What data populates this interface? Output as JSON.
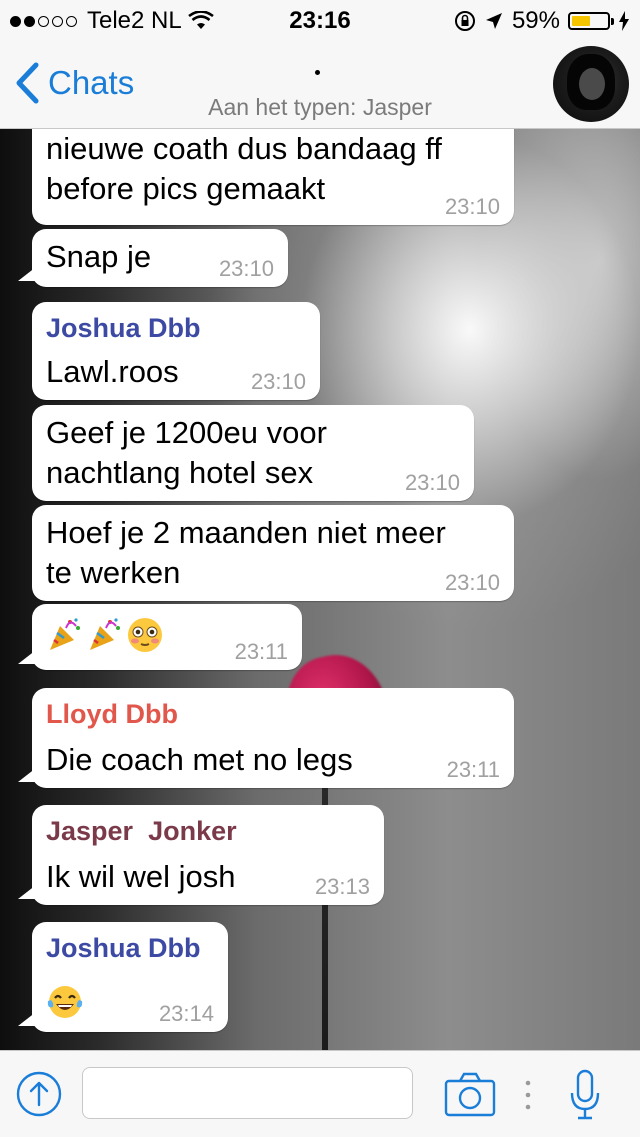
{
  "status_bar": {
    "carrier": "Tele2 NL",
    "time": "23:16",
    "battery_percent": "59%",
    "battery_level": 0.59
  },
  "nav": {
    "back_label": "Chats",
    "subtitle": "Aan het typen: Jasper"
  },
  "messages": [
    {
      "sender": "",
      "text": "nieuwe coath dus bandaag ff\nbefore pics gemaakt",
      "time": "23:10"
    },
    {
      "sender": "",
      "text": "Snap je",
      "time": "23:10"
    },
    {
      "sender": "Joshua Dbb",
      "text": "Lawl.roos",
      "time": "23:10",
      "sender_color": "#3d4aa3"
    },
    {
      "sender": "",
      "text": "Geef je 1200eu voor\nnachtlang hotel sex",
      "time": "23:10"
    },
    {
      "sender": "",
      "text": "Hoef je 2 maanden niet meer\nte werken",
      "time": "23:10"
    },
    {
      "sender": "",
      "text": "party-popper party-popper flushed-face",
      "time": "23:11"
    },
    {
      "sender": "Lloyd Dbb",
      "text": "Die coach met no legs",
      "time": "23:11",
      "sender_color": "#e2574c"
    },
    {
      "sender": "Jasper  Jonker",
      "text": "Ik wil wel josh",
      "time": "23:13",
      "sender_color": "#7b3a4a"
    },
    {
      "sender": "Joshua Dbb",
      "text": "tears-of-joy",
      "time": "23:14",
      "sender_color": "#3d4aa3"
    }
  ],
  "input": {
    "placeholder": ""
  },
  "colors": {
    "accent": "#1a7dd8",
    "bubble": "#ffffff",
    "timestamp": "#a0a0a0"
  }
}
